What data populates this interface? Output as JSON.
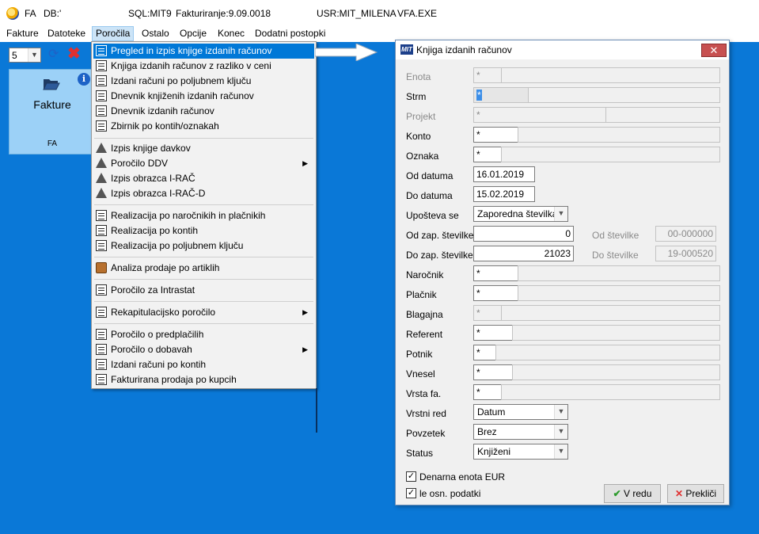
{
  "titlebar": {
    "app": "FA",
    "db": "DB:'",
    "sql": "SQL:MIT9",
    "fakturiranje": "Fakturiranje:9.09.0018",
    "user": "USR:MIT_MILENA",
    "exe": "VFA.EXE"
  },
  "menubar": [
    "Fakture",
    "Datoteke",
    "Poročila",
    "Ostalo",
    "Opcije",
    "Konec",
    "Dodatni postopki"
  ],
  "toolbar": {
    "count_value": "5"
  },
  "tile": {
    "title": "Fakture",
    "subtitle": "FA"
  },
  "dropdown": [
    {
      "label": "Pregled in izpis knjige izdanih računov",
      "icon": "list-icon"
    },
    {
      "label": "Knjiga izdanih računov z razliko v ceni",
      "icon": "list-icon"
    },
    {
      "label": "Izdani računi po poljubnem ključu",
      "icon": "list-icon"
    },
    {
      "label": "Dnevnik knjiženih izdanih računov",
      "icon": "list-icon"
    },
    {
      "label": "Dnevnik izdanih računov",
      "icon": "list-icon"
    },
    {
      "label": "Zbirnik po kontih/oznakah",
      "icon": "list-icon"
    },
    {
      "label": "Izpis knjige davkov",
      "icon": "durs-icon"
    },
    {
      "label": "Poročilo DDV",
      "icon": "durs-icon"
    },
    {
      "label": "Izpis obrazca I-RAČ",
      "icon": "durs-icon"
    },
    {
      "label": "Izpis obrazca I-RAČ-D",
      "icon": "durs-icon"
    },
    {
      "label": "Realizacija po naročnikih in plačnikih",
      "icon": "list-icon"
    },
    {
      "label": "Realizacija po kontih",
      "icon": "list-icon"
    },
    {
      "label": "Realizacija po poljubnem ključu",
      "icon": "list-icon"
    },
    {
      "label": "Analiza prodaje po artiklih",
      "icon": "box-icon"
    },
    {
      "label": "Poročilo za Intrastat",
      "icon": "list-icon"
    },
    {
      "label": "Rekapitulacijsko poročilo",
      "icon": "list-icon"
    },
    {
      "label": "Poročilo o predplačilih",
      "icon": "list-icon"
    },
    {
      "label": "Poročilo o dobavah",
      "icon": "list-icon"
    },
    {
      "label": "Izdani računi po kontih",
      "icon": "list-icon"
    },
    {
      "label": "Fakturirana prodaja po kupcih",
      "icon": "list-icon"
    }
  ],
  "dialog": {
    "title": "Knjiga izdanih računov",
    "fields": {
      "enota": {
        "label": "Enota",
        "value": "*"
      },
      "strm": {
        "label": "Strm",
        "value": "*"
      },
      "projekt": {
        "label": "Projekt",
        "value": "*"
      },
      "konto": {
        "label": "Konto",
        "value": "*"
      },
      "oznaka": {
        "label": "Oznaka",
        "value": "*"
      },
      "od_datuma": {
        "label": "Od datuma",
        "value": "16.01.2019"
      },
      "do_datuma": {
        "label": "Do datuma",
        "value": "15.02.2019"
      },
      "uposteva": {
        "label": "Upošteva se",
        "value": "Zaporedna številka"
      },
      "od_zap": {
        "label": "Od zap. številke",
        "value": "0",
        "side_label": "Od številke",
        "side_value": "00-000000"
      },
      "do_zap": {
        "label": "Do zap. številke",
        "value": "21023",
        "side_label": "Do številke",
        "side_value": "19-000520"
      },
      "narocnik": {
        "label": "Naročnik",
        "value": "*"
      },
      "placnik": {
        "label": "Plačnik",
        "value": "*"
      },
      "blagajna": {
        "label": "Blagajna",
        "value": "*"
      },
      "referent": {
        "label": "Referent",
        "value": "*"
      },
      "potnik": {
        "label": "Potnik",
        "value": "*"
      },
      "vnesel": {
        "label": "Vnesel",
        "value": "*"
      },
      "vrsta_fa": {
        "label": "Vrsta fa.",
        "value": "*"
      },
      "vrstni_red": {
        "label": "Vrstni red",
        "value": "Datum"
      },
      "povzetek": {
        "label": "Povzetek",
        "value": "Brez"
      },
      "status": {
        "label": "Status",
        "value": "Knjiženi"
      }
    },
    "checkboxes": {
      "denarna": {
        "label": "Denarna enota EUR",
        "checked": true
      },
      "osn": {
        "label": "le osn. podatki",
        "checked": true
      }
    },
    "buttons": {
      "ok": "V redu",
      "cancel": "Prekliči"
    }
  }
}
